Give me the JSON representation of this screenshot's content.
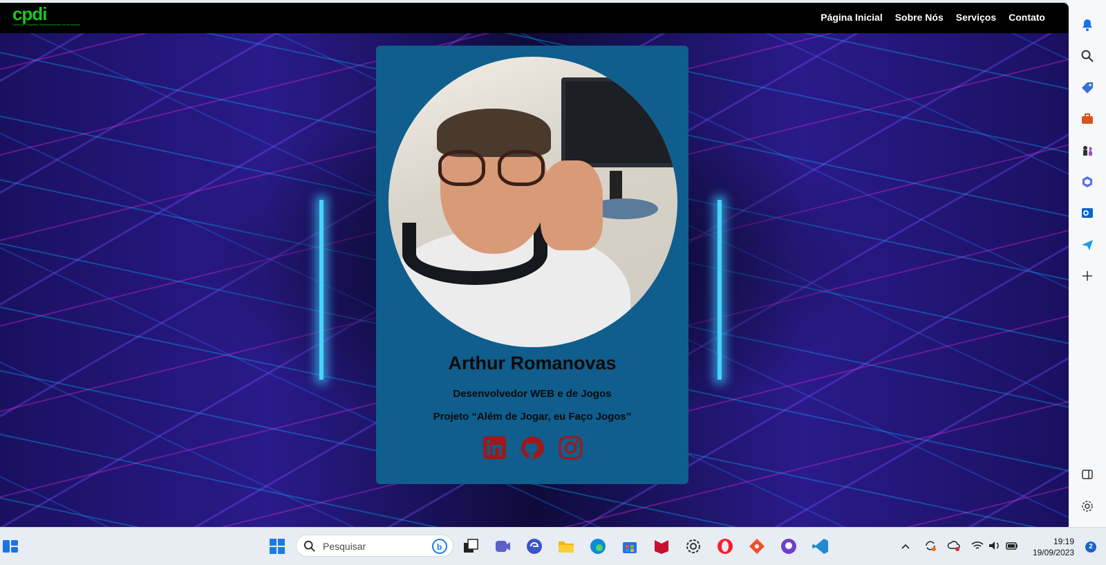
{
  "site": {
    "logo": {
      "text": "cpdi",
      "subtitle": "Centro de Pesquisa e Desenvolvimento em Informática"
    },
    "nav": [
      "Página Inicial",
      "Sobre Nós",
      "Serviços",
      "Contato"
    ]
  },
  "profile": {
    "name": "Arthur Romanovas",
    "role": "Desenvolvedor WEB e de Jogos",
    "project": "Projeto “Além de Jogar, eu Faço Jogos”",
    "social_icons": [
      "linkedin-icon",
      "github-icon",
      "instagram-icon"
    ],
    "card_color": "#0f5e8e",
    "social_color": "#a01818"
  },
  "edge_sidebar": {
    "icons": [
      "bell-icon",
      "search-icon",
      "tag-icon",
      "toolbox-icon",
      "chess-icon",
      "copilot-icon",
      "outlook-icon",
      "send-icon",
      "add-icon",
      "split-view-icon",
      "settings-icon"
    ]
  },
  "taskbar": {
    "search_placeholder": "Pesquisar",
    "apps": [
      "start-icon",
      "task-view-icon",
      "teams-icon",
      "edge-app-icon",
      "file-explorer-icon",
      "edge-icon",
      "store-icon",
      "mcafee-icon",
      "settings-icon",
      "opera-icon",
      "git-app-icon",
      "github-desktop-icon",
      "vscode-icon"
    ],
    "time": "19:19",
    "date": "19/09/2023",
    "notifications": "2"
  }
}
